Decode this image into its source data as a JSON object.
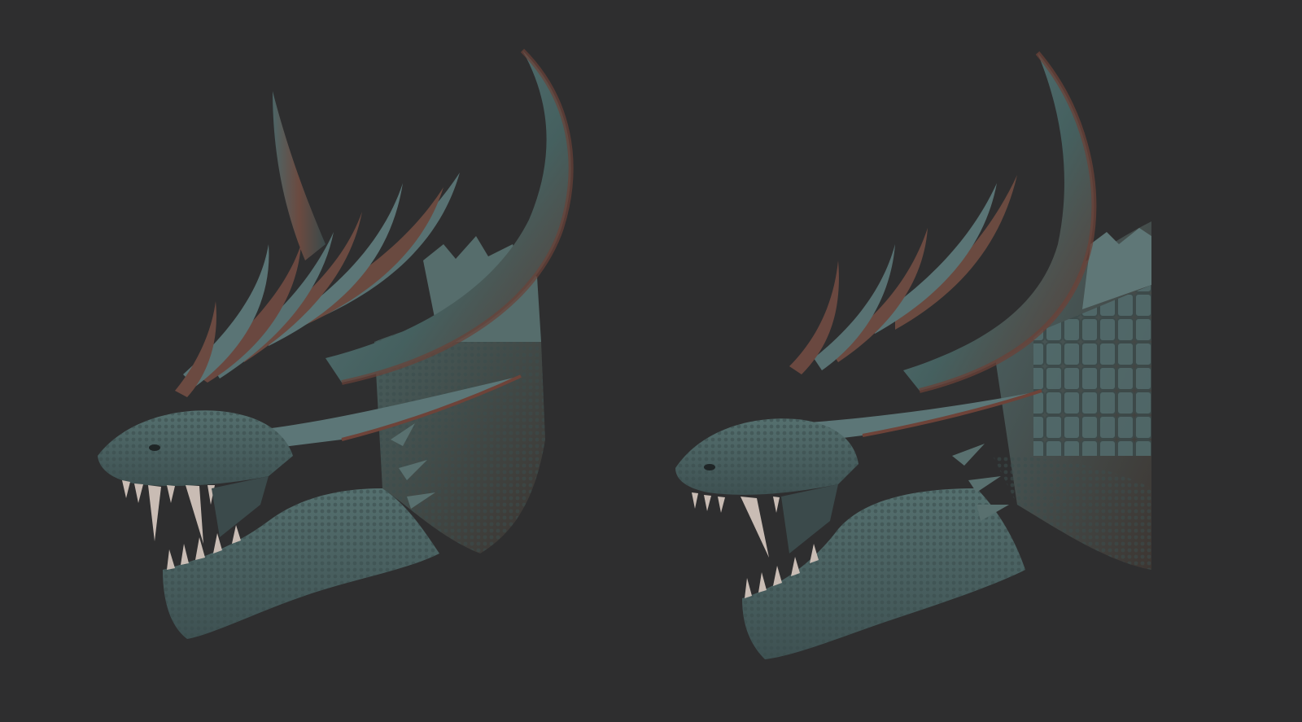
{
  "scene": {
    "background_color": "#2e2e2f",
    "views": [
      {
        "name": "dragon-head-side-view",
        "skin_color": "#4a6468",
        "accent_color": "#6a4238"
      },
      {
        "name": "dragon-head-three-quarter-view",
        "skin_color": "#4a6468",
        "accent_color": "#6a4238"
      }
    ]
  }
}
